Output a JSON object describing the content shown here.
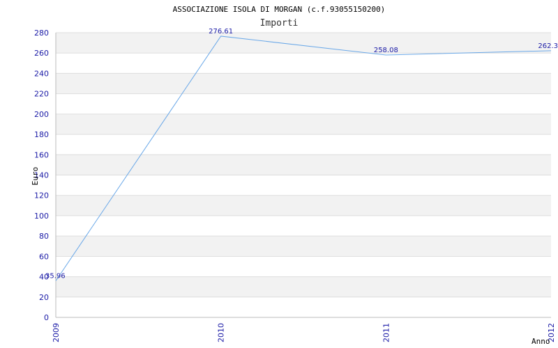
{
  "chart_data": {
    "type": "line",
    "title": "ASSOCIAZIONE ISOLA DI MORGAN (c.f.93055150200)",
    "subtitle": "Importi",
    "xlabel": "Anno",
    "ylabel": "Euro",
    "categories": [
      "2009",
      "2010",
      "2011",
      "2012"
    ],
    "series": [
      {
        "values": [
          35.96,
          276.61,
          258.08,
          262.3
        ],
        "labels": [
          "35.96",
          "276.61",
          "258.08",
          "262.3"
        ]
      }
    ],
    "ylim": [
      0,
      280
    ],
    "yticks": [
      0,
      20,
      40,
      60,
      80,
      100,
      120,
      140,
      160,
      180,
      200,
      220,
      240,
      260,
      280
    ],
    "grid": true,
    "band_colors": [
      "#ffffff",
      "#f2f2f2"
    ],
    "line_color": "#6aa8e8",
    "text_color": "#1a1aa6"
  }
}
